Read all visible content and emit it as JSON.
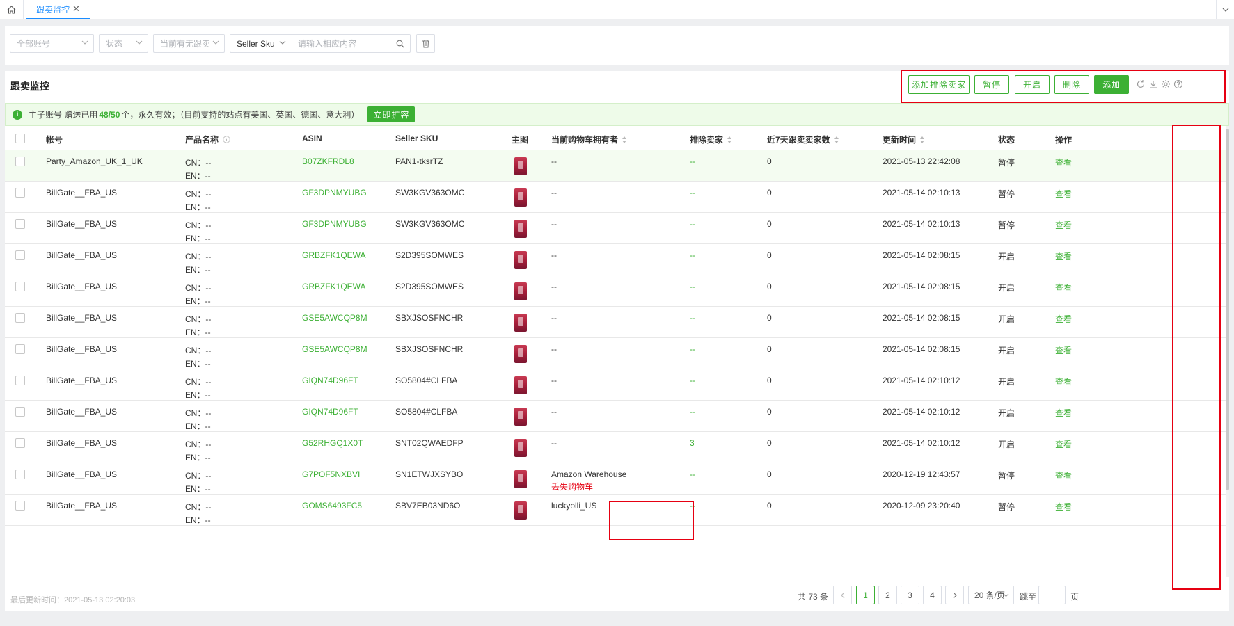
{
  "tabs": {
    "active_label": "跟卖监控",
    "close_glyph": "✕"
  },
  "filters": {
    "account_placeholder": "全部账号",
    "status_placeholder": "状态",
    "follow_placeholder": "当前有无跟卖",
    "field_select": "Seller Sku",
    "search_placeholder": "请输入相应内容"
  },
  "panel": {
    "title": "跟卖监控",
    "buttons": {
      "add_exclude": "添加排除卖家",
      "pause": "暂停",
      "start": "开启",
      "delete": "删除",
      "add": "添加"
    }
  },
  "notice": {
    "prefix": "主子账号 赠送已用",
    "used": "48/50",
    "suffix": "个，永久有效；（目前支持的站点有美国、英国、德国、意大利）",
    "expand": "立即扩容"
  },
  "columns": {
    "account": "帐号",
    "product": "产品名称",
    "asin": "ASIN",
    "sku": "Seller SKU",
    "image": "主图",
    "owner": "当前购物车拥有者",
    "exclude": "排除卖家",
    "recent": "近7天跟卖卖家数",
    "updated": "更新时间",
    "status": "状态",
    "ops": "操作"
  },
  "rows": [
    {
      "account": "Party_Amazon_UK_1_UK",
      "cn": "CN：--",
      "en": "EN：--",
      "asin": "B07ZKFRDL8",
      "sku": "PAN1-tksrTZ",
      "owner": "--",
      "owner_note": "",
      "exclude": "--",
      "recent": "0",
      "updated": "2021-05-13 22:42:08",
      "status": "暂停",
      "op": "查看"
    },
    {
      "account": "BillGate__FBA_US",
      "cn": "CN：--",
      "en": "EN：--",
      "asin": "GF3DPNMYUBG",
      "sku": "SW3KGV363OMC",
      "owner": "--",
      "owner_note": "",
      "exclude": "--",
      "recent": "0",
      "updated": "2021-05-14 02:10:13",
      "status": "暂停",
      "op": "查看"
    },
    {
      "account": "BillGate__FBA_US",
      "cn": "CN：--",
      "en": "EN：--",
      "asin": "GF3DPNMYUBG",
      "sku": "SW3KGV363OMC",
      "owner": "--",
      "owner_note": "",
      "exclude": "--",
      "recent": "0",
      "updated": "2021-05-14 02:10:13",
      "status": "暂停",
      "op": "查看"
    },
    {
      "account": "BillGate__FBA_US",
      "cn": "CN：--",
      "en": "EN：--",
      "asin": "GRBZFK1QEWA",
      "sku": "S2D395SOMWES",
      "owner": "--",
      "owner_note": "",
      "exclude": "--",
      "recent": "0",
      "updated": "2021-05-14 02:08:15",
      "status": "开启",
      "op": "查看"
    },
    {
      "account": "BillGate__FBA_US",
      "cn": "CN：--",
      "en": "EN：--",
      "asin": "GRBZFK1QEWA",
      "sku": "S2D395SOMWES",
      "owner": "--",
      "owner_note": "",
      "exclude": "--",
      "recent": "0",
      "updated": "2021-05-14 02:08:15",
      "status": "开启",
      "op": "查看"
    },
    {
      "account": "BillGate__FBA_US",
      "cn": "CN：--",
      "en": "EN：--",
      "asin": "GSE5AWCQP8M",
      "sku": "SBXJSOSFNCHR",
      "owner": "--",
      "owner_note": "",
      "exclude": "--",
      "recent": "0",
      "updated": "2021-05-14 02:08:15",
      "status": "开启",
      "op": "查看"
    },
    {
      "account": "BillGate__FBA_US",
      "cn": "CN：--",
      "en": "EN：--",
      "asin": "GSE5AWCQP8M",
      "sku": "SBXJSOSFNCHR",
      "owner": "--",
      "owner_note": "",
      "exclude": "--",
      "recent": "0",
      "updated": "2021-05-14 02:08:15",
      "status": "开启",
      "op": "查看"
    },
    {
      "account": "BillGate__FBA_US",
      "cn": "CN：--",
      "en": "EN：--",
      "asin": "GIQN74D96FT",
      "sku": "SO5804#CLFBA",
      "owner": "--",
      "owner_note": "",
      "exclude": "--",
      "recent": "0",
      "updated": "2021-05-14 02:10:12",
      "status": "开启",
      "op": "查看"
    },
    {
      "account": "BillGate__FBA_US",
      "cn": "CN：--",
      "en": "EN：--",
      "asin": "GIQN74D96FT",
      "sku": "SO5804#CLFBA",
      "owner": "--",
      "owner_note": "",
      "exclude": "--",
      "recent": "0",
      "updated": "2021-05-14 02:10:12",
      "status": "开启",
      "op": "查看"
    },
    {
      "account": "BillGate__FBA_US",
      "cn": "CN：--",
      "en": "EN：--",
      "asin": "G52RHGQ1X0T",
      "sku": "SNT02QWAEDFP",
      "owner": "--",
      "owner_note": "",
      "exclude": "3",
      "recent": "0",
      "updated": "2021-05-14 02:10:12",
      "status": "开启",
      "op": "查看"
    },
    {
      "account": "BillGate__FBA_US",
      "cn": "CN：--",
      "en": "EN：--",
      "asin": "G7POF5NXBVI",
      "sku": "SN1ETWJXSYBO",
      "owner": "Amazon Warehouse",
      "owner_note": "丢失购物车",
      "exclude": "--",
      "recent": "0",
      "updated": "2020-12-19 12:43:57",
      "status": "暂停",
      "op": "查看"
    },
    {
      "account": "BillGate__FBA_US",
      "cn": "CN：--",
      "en": "EN：--",
      "asin": "GOMS6493FC5",
      "sku": "SBV7EB03ND6O",
      "owner": "luckyolli_US",
      "owner_note": "",
      "exclude": "--",
      "recent": "0",
      "updated": "2020-12-09 23:20:40",
      "status": "暂停",
      "op": "查看"
    }
  ],
  "footer": {
    "last_updated": "最后更新时间：2021-05-13 02:20:03",
    "total": "共 73 条",
    "pages": [
      "1",
      "2",
      "3",
      "4"
    ],
    "page_size": "20 条/页",
    "jump_label": "跳至",
    "page_unit": "页"
  },
  "colors": {
    "accent": "#3cb034",
    "tab_blue": "#1a8cff",
    "highlight_red": "#e60012"
  },
  "icons": [
    "home-icon",
    "close-icon",
    "chevron-down-icon",
    "search-icon",
    "trash-icon",
    "refresh-icon",
    "download-icon",
    "settings-icon",
    "help-icon",
    "info-icon",
    "sort-icon",
    "chevron-left-icon",
    "chevron-right-icon"
  ]
}
